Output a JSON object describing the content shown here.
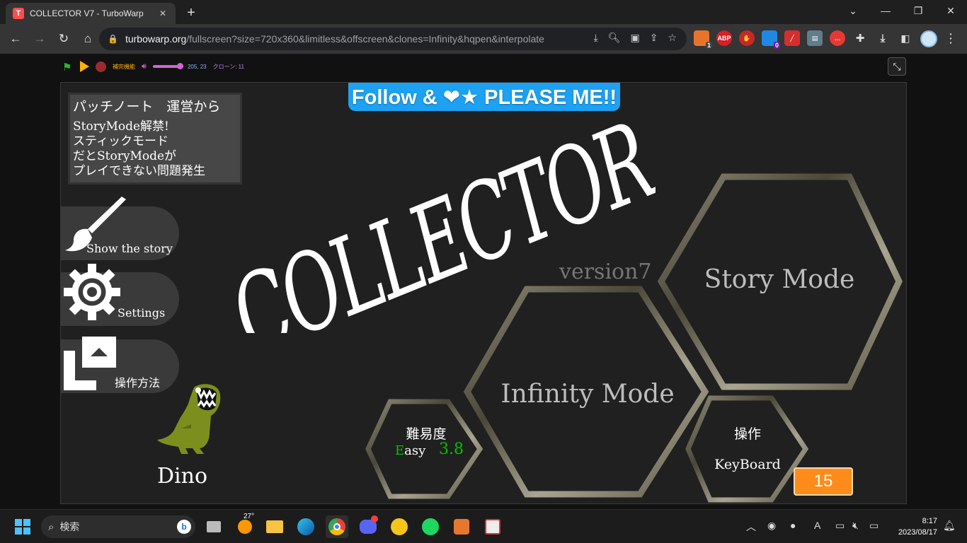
{
  "browser": {
    "tab_title": "COLLECTOR V7 - TurboWarp",
    "tab_favicon": "T",
    "url_host": "turbowarp.org",
    "url_path": "/fullscreen?size=720x360&limitless&offscreen&clones=Infinity&hqpen&interpolate",
    "ext_badge_1": "1",
    "ext_badge_2": "0",
    "ext_abp": "ABP"
  },
  "turbowarp": {
    "addon_label": "補完機能",
    "coords": "205, 23",
    "clones": "クローン: 11"
  },
  "game": {
    "follow_banner": "Follow & ❤★ PLEASE ME!!",
    "logo_text": "COLLECTOR",
    "version": "version7",
    "patch": {
      "title": "パッチノート　運営から",
      "lines": [
        "StoryMode解禁!",
        "スティックモード",
        "だとStoryModeが",
        "プレイできない問題発生"
      ]
    },
    "buttons": {
      "story": "Show the story",
      "settings": "Settings",
      "controls": "操作方法"
    },
    "character": "Dino",
    "modes": {
      "story": "Story Mode",
      "infinity": "Infinity Mode"
    },
    "difficulty": {
      "title": "難易度",
      "level_initial": "E",
      "level_rest": "asy",
      "value": "3.8"
    },
    "control": {
      "title": "操作",
      "value": "KeyBoard"
    },
    "score": "15"
  },
  "taskbar": {
    "search_label": "検索",
    "weather_temp": "27°",
    "time": "8:17",
    "date": "2023/08/17"
  },
  "colors": {
    "accent_blue": "#1da1f2",
    "score_orange": "#ff8c1a",
    "difficulty_green": "#00c000"
  }
}
